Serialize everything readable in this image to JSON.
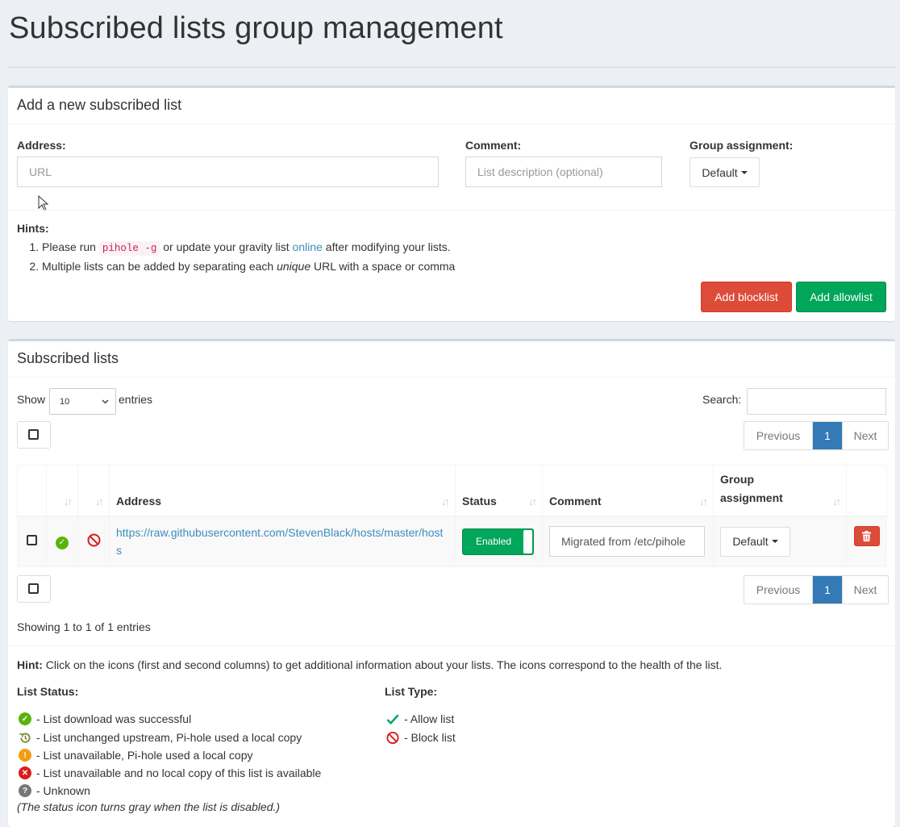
{
  "page": {
    "title": "Subscribed lists group management"
  },
  "add_box": {
    "title": "Add a new subscribed list",
    "address_label": "Address:",
    "address_placeholder": "URL",
    "comment_label": "Comment:",
    "comment_placeholder": "List description (optional)",
    "group_label": "Group assignment:",
    "group_value": "Default",
    "hints_label": "Hints:",
    "hint1_pre": "Please run",
    "hint1_code": "pihole -g",
    "hint1_mid": "or update your gravity list",
    "hint1_link": "online",
    "hint1_post": "after modifying your lists.",
    "hint2_pre": "Multiple lists can be added by separating each",
    "hint2_em": "unique",
    "hint2_post": "URL with a space or comma",
    "add_blocklist": "Add blocklist",
    "add_allowlist": "Add allowlist"
  },
  "lists_box": {
    "title": "Subscribed lists",
    "show_label": "Show",
    "show_value": "10",
    "entries_label": "entries",
    "search_label": "Search:",
    "pager": {
      "previous": "Previous",
      "current": "1",
      "next": "Next"
    },
    "columns": [
      "Address",
      "Status",
      "Comment",
      "Group assignment"
    ],
    "rows": [
      {
        "address": "https://raw.githubusercontent.com/StevenBlack/hosts/master/hosts",
        "status": "Enabled",
        "comment": "Migrated from /etc/pihole",
        "group": "Default"
      }
    ],
    "showing": "Showing 1 to 1 of 1 entries",
    "hint_bold": "Hint:",
    "hint_text": "Click on the icons (first and second columns) to get additional information about your lists. The icons correspond to the health of the list.",
    "list_status_label": "List Status:",
    "list_status_items": [
      "- List download was successful",
      "- List unchanged upstream, Pi-hole used a local copy",
      "- List unavailable, Pi-hole used a local copy",
      "- List unavailable and no local copy of this list is available",
      "- Unknown"
    ],
    "status_note": "(The status icon turns gray when the list is disabled.)",
    "list_type_label": "List Type:",
    "list_type_items": [
      "- Allow list",
      "- Block list"
    ]
  },
  "colors": {
    "danger": "#dd4b39",
    "success": "#00a65a",
    "primary": "#337ab7",
    "link": "#3c8dbc"
  }
}
